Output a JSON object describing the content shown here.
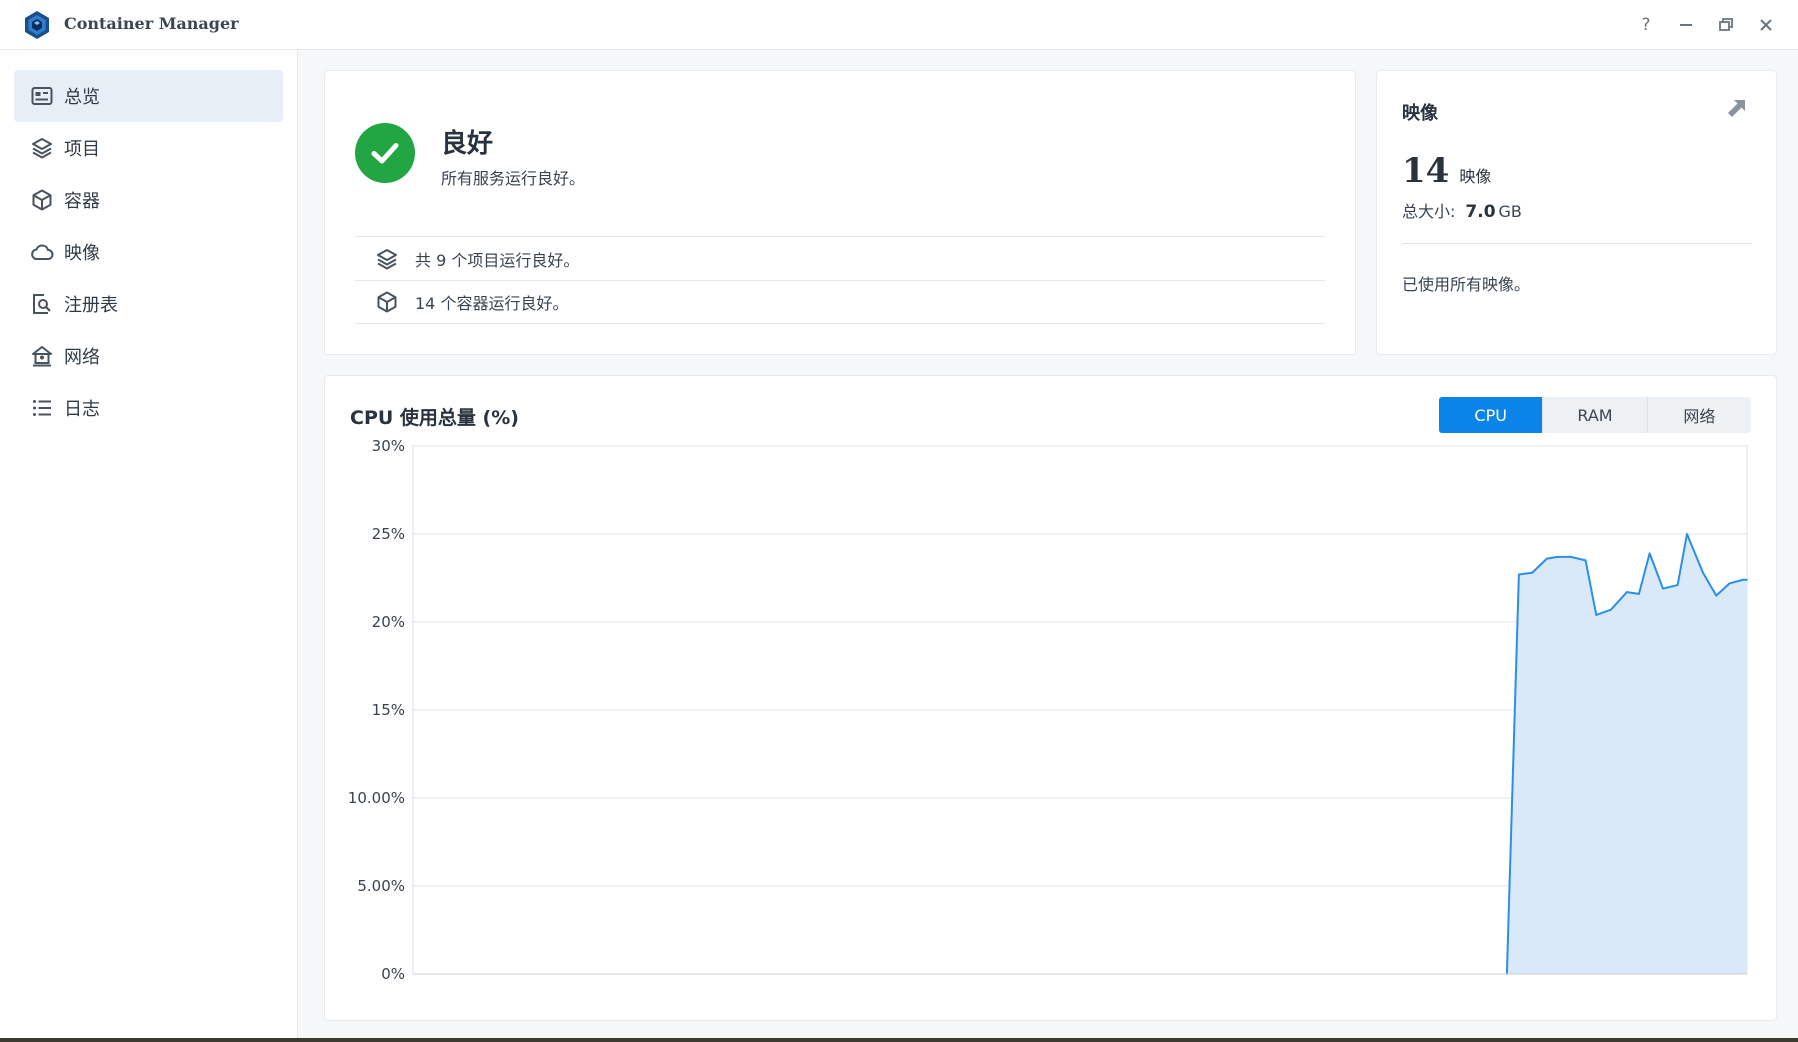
{
  "app": {
    "title": "Container Manager",
    "accent_color": "#0a84e8",
    "success_color": "#22a543"
  },
  "window_controls": [
    {
      "name": "help-button",
      "icon": "question-icon",
      "glyph": "?"
    },
    {
      "name": "minimize-button",
      "icon": "minimize-icon"
    },
    {
      "name": "restore-button",
      "icon": "restore-icon"
    },
    {
      "name": "close-button",
      "icon": "close-icon"
    }
  ],
  "sidebar": {
    "items": [
      {
        "label": "总览",
        "icon": "overview-icon",
        "active": true
      },
      {
        "label": "项目",
        "icon": "layers-icon",
        "active": false
      },
      {
        "label": "容器",
        "icon": "cube-icon",
        "active": false
      },
      {
        "label": "映像",
        "icon": "cloud-icon",
        "active": false
      },
      {
        "label": "注册表",
        "icon": "registry-search-icon",
        "active": false
      },
      {
        "label": "网络",
        "icon": "network-home-icon",
        "active": false
      },
      {
        "label": "日志",
        "icon": "list-icon",
        "active": false
      }
    ]
  },
  "status": {
    "title": "良好",
    "subtitle": "所有服务运行良好。",
    "rows": [
      {
        "icon": "layers-icon",
        "text": "共 9 个项目运行良好。"
      },
      {
        "icon": "cube-icon",
        "text": "14 个容器运行良好。"
      }
    ]
  },
  "images": {
    "title": "映像",
    "count": "14",
    "count_unit": "映像",
    "size_label": "总大小:",
    "size_value": "7.0",
    "size_unit": "GB",
    "note": "已使用所有映像。"
  },
  "chart": {
    "title": "CPU 使用总量 (%)",
    "tabs": [
      {
        "label": "CPU",
        "active": true
      },
      {
        "label": "RAM",
        "active": false
      },
      {
        "label": "网络",
        "active": false
      }
    ]
  },
  "chart_data": {
    "type": "area",
    "xlabel": "",
    "ylabel": "",
    "ylim": [
      0,
      30
    ],
    "xlim": [
      0,
      100
    ],
    "y_ticks": [
      {
        "value": 0,
        "label": "0%"
      },
      {
        "value": 5,
        "label": "5.00%"
      },
      {
        "value": 10,
        "label": "10.00%"
      },
      {
        "value": 15,
        "label": "15%"
      },
      {
        "value": 20,
        "label": "20%"
      },
      {
        "value": 25,
        "label": "25%"
      },
      {
        "value": 30,
        "label": "30%"
      }
    ],
    "grid": true,
    "line_color": "#2a8fe6",
    "fill_color": "#d9e9f8",
    "series": [
      {
        "x": [
          82.0,
          82.9,
          83.9,
          85.0,
          85.8,
          86.8,
          87.9,
          88.7,
          89.8,
          91.0,
          91.9,
          92.7,
          93.7,
          94.8,
          95.5,
          96.7,
          97.7,
          98.7,
          99.7,
          100.0
        ],
        "y": [
          0.0,
          22.7,
          22.8,
          23.6,
          23.7,
          23.7,
          23.5,
          20.4,
          20.7,
          21.7,
          21.6,
          23.9,
          21.9,
          22.1,
          25.0,
          22.8,
          21.5,
          22.2,
          22.4,
          22.4
        ]
      }
    ]
  }
}
